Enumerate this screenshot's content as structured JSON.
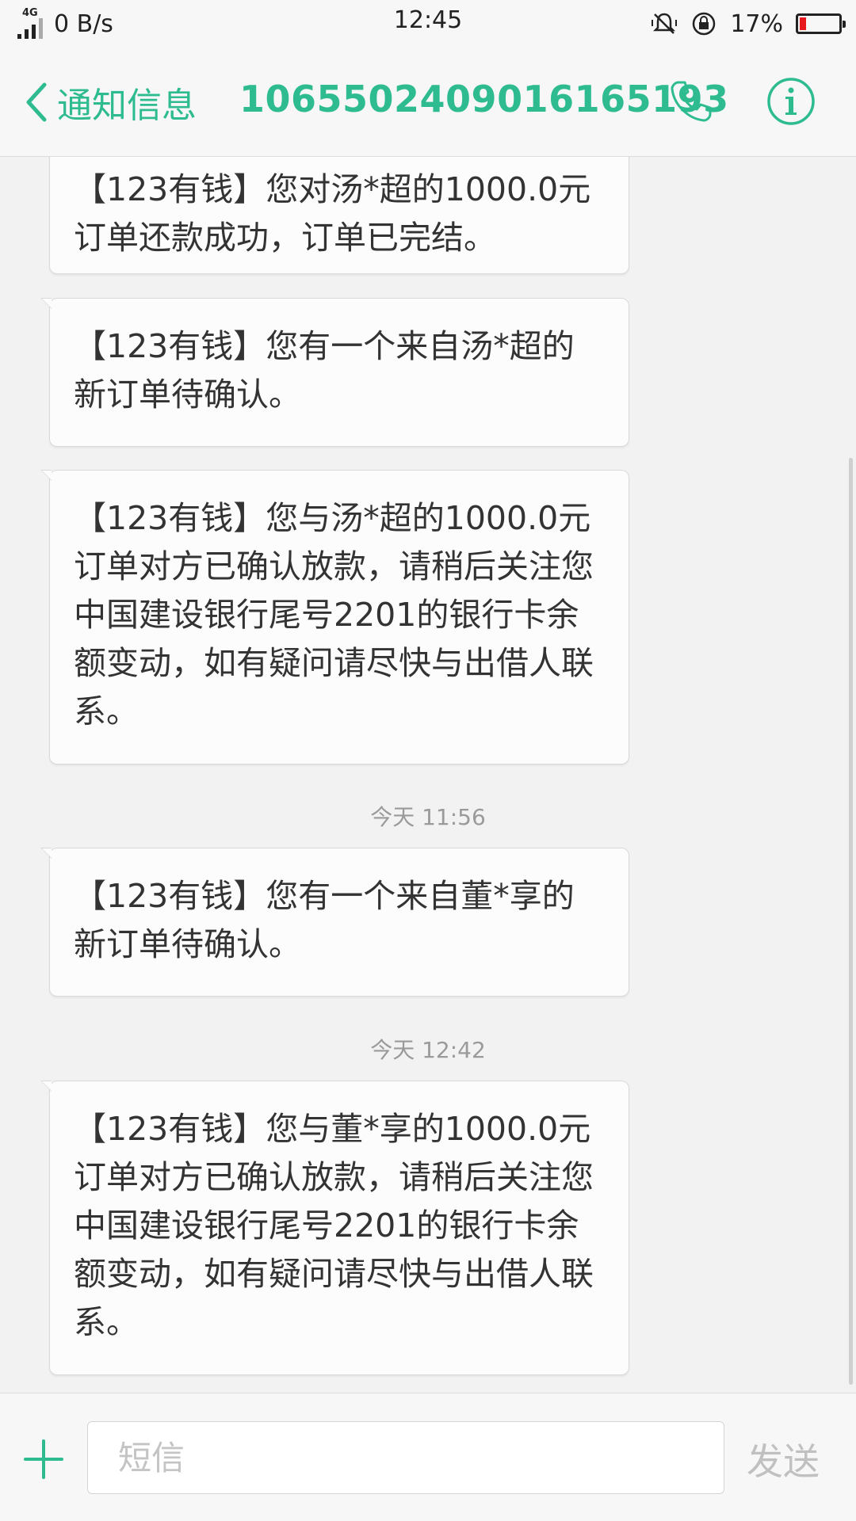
{
  "status_bar": {
    "network_type": "4G",
    "net_speed": "0 B/s",
    "time": "12:45",
    "battery_text": "17%",
    "battery_level": 0.17
  },
  "header": {
    "back_label": "通知信息",
    "sender_number": "1065502409016165193"
  },
  "messages": [
    {
      "text": "【123有钱】您对汤*超的1000.0元订单还款成功，订单已完结。"
    },
    {
      "text": "【123有钱】您有一个来自汤*超的新订单待确认。"
    },
    {
      "text": "【123有钱】您与汤*超的1000.0元订单对方已确认放款，请稍后关注您中国建设银行尾号2201的银行卡余额变动，如有疑问请尽快与出借人联系。"
    },
    {
      "text": "【123有钱】您有一个来自董*享的新订单待确认。"
    },
    {
      "text": "【123有钱】您与董*享的1000.0元订单对方已确认放款，请稍后关注您中国建设银行尾号2201的银行卡余额变动，如有疑问请尽快与出借人联系。"
    }
  ],
  "timestamps": [
    "今天 11:56",
    "今天 12:42"
  ],
  "compose": {
    "placeholder": "短信",
    "send_label": "发送"
  },
  "colors": {
    "accent": "#2dbb8f",
    "battery_low": "#e8191e"
  }
}
